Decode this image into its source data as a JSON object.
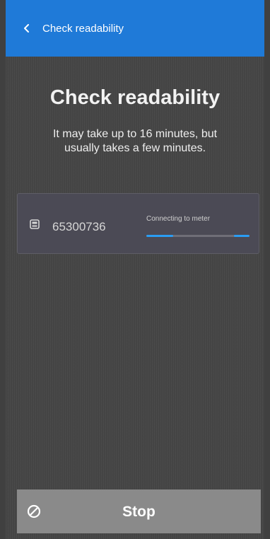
{
  "appbar": {
    "title": "Check readability",
    "back_icon": "chevron-left-icon",
    "color": "#1f7ad8"
  },
  "main": {
    "heading": "Check readability",
    "subtitle_line1": "It may take up to 16 minutes, but",
    "subtitle_line2": "usually takes a few minutes."
  },
  "meter": {
    "icon": "meter-icon",
    "number": "65300736",
    "status": "Connecting to meter",
    "progress_state": "indeterminate",
    "progress_color": "#2a9df4"
  },
  "footer": {
    "stop_icon": "cancel-icon",
    "stop_label": "Stop"
  }
}
